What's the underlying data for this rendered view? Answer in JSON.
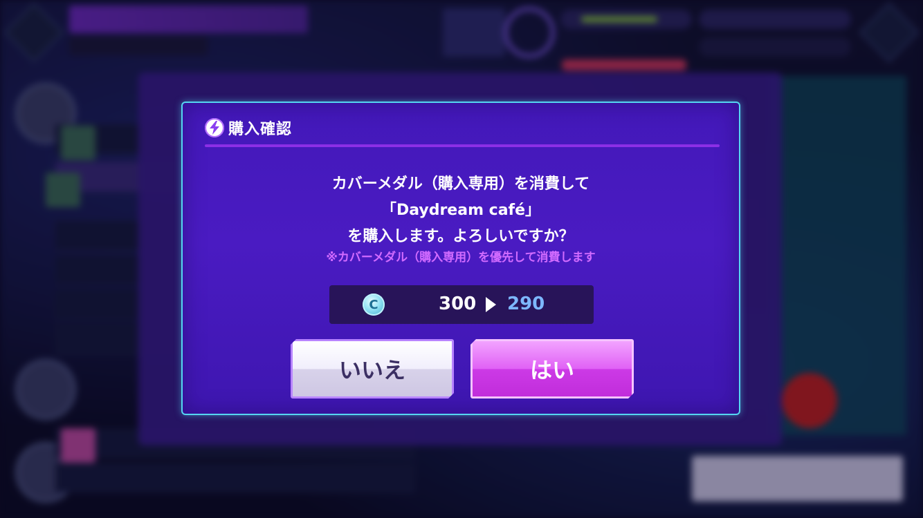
{
  "dialog": {
    "title": "購入確認",
    "title_icon": "lightning-icon",
    "message_line1": "カバーメダル（購入専用）を消費して",
    "message_line2": "「Daydream café」",
    "message_line3": "を購入します。よろしいですか？",
    "note": "※カバーメダル（購入専用）を優先して消費します",
    "currency_icon": "cover-medal-coin-icon",
    "currency_icon_letter": "C",
    "current_amount": "300",
    "after_amount": "290",
    "no_label": "いいえ",
    "yes_label": "はい"
  },
  "colors": {
    "dialog_border": "#55d6f2",
    "dialog_bg": "#4318b9",
    "title_underline": "#8c2fe6",
    "note_text": "#d26bff",
    "after_amount": "#7db7ff",
    "yes_button": "#e061f5",
    "no_button": "#f1eefc"
  }
}
